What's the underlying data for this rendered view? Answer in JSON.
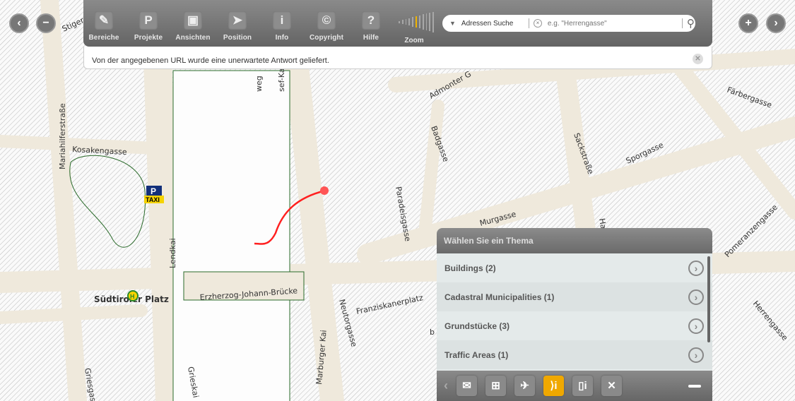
{
  "map": {
    "streets": [
      "Stigergasse",
      "Mariahilferstraße",
      "Kosakengasse",
      "Lendkai",
      "Südtiroler Platz",
      "Erzherzog-Johann-Brücke",
      "Griesgasse",
      "Grieskai",
      "Marburger Kai",
      "Neutorgasse",
      "Franziskanerplatz",
      "Murgasse",
      "Paradeisgasse",
      "Badgasse",
      "Admonter G",
      "Sackstraße",
      "Sporgasse",
      "Färbergasse",
      "Herrengasse",
      "Pomeranzengasse",
      "sef-Kai",
      "weg",
      "Ha",
      "b"
    ],
    "taxi_label": "TAXI",
    "parking_label": "P",
    "tram_label": "H",
    "track_color": "#ff2020"
  },
  "toolbar": {
    "items": [
      {
        "label": "Bereiche",
        "icon": "✎"
      },
      {
        "label": "Projekte",
        "icon": "P"
      },
      {
        "label": "Ansichten",
        "icon": "▣"
      },
      {
        "label": "Position",
        "icon": "➤"
      },
      {
        "label": "Info",
        "icon": "i"
      },
      {
        "label": "Copyright",
        "icon": "©"
      },
      {
        "label": "Hilfe",
        "icon": "?"
      }
    ],
    "zoom_label": "Zoom",
    "zoom_level": 5,
    "zoom_steps": 11,
    "accent": "#f0b400"
  },
  "search": {
    "type": "Adressen Suche",
    "placeholder": "e.g. \"Herrengasse\""
  },
  "message": "Von der angegebenen URL wurde eine unerwartete Antwort geliefert.",
  "panel": {
    "title": "Wählen Sie ein Thema",
    "items": [
      "Buildings (2)",
      "Cadastral Municipalities (1)",
      "Grundstücke (3)",
      "Traffic Areas (1)"
    ]
  }
}
